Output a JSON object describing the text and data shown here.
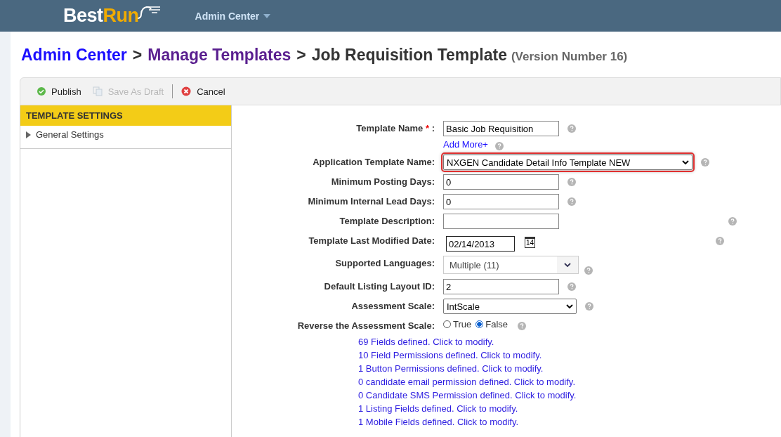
{
  "header": {
    "logo_first": "Best",
    "logo_second": "Run",
    "menu": "Admin Center"
  },
  "breadcrumb": [
    {
      "label": "Admin Center",
      "kind": "link"
    },
    {
      "separator": ">",
      "label": "Manage Templates",
      "kind": "visited"
    },
    {
      "separator": ">",
      "label": "Job Requisition Template",
      "kind": "current"
    }
  ],
  "version": "(Version Number 16)",
  "toolbar": [
    {
      "label": "Publish",
      "kind": "publish",
      "disabled": false
    },
    {
      "label": "Save As Draft",
      "kind": "draft",
      "disabled": true
    },
    {
      "label": "Cancel",
      "kind": "cancel",
      "disabled": false
    }
  ],
  "sidebar": {
    "title": "TEMPLATE SETTINGS",
    "items": [
      {
        "label": "General Settings",
        "expanded": false
      }
    ]
  },
  "form": [
    {
      "label": "Template Name",
      "required_mark": "*",
      "colon": ":",
      "kind": "text",
      "value": "Basic Job Requisition",
      "extra_link": "Add More+"
    },
    {
      "label": "Application Template Name:",
      "kind": "select",
      "value": "NXGEN Candidate Detail Info Template NEW",
      "highlighted": true
    },
    {
      "label": "Minimum Posting Days:",
      "kind": "text",
      "value": "0"
    },
    {
      "label": "Minimum Internal Lead Days:",
      "kind": "text",
      "value": "0"
    },
    {
      "label": "Template Description:",
      "kind": "text"
    },
    {
      "label": "Template Last Modified Date:",
      "kind": "date",
      "value": "02/14/2013",
      "calendar_day": "14"
    },
    {
      "label": "Supported Languages:",
      "kind": "multiselect",
      "value": "Multiple (11)"
    },
    {
      "label": "Default Listing Layout ID:",
      "kind": "text",
      "value": "2"
    },
    {
      "label": "Assessment Scale:",
      "kind": "select",
      "value": "IntScale",
      "highlighted": false
    },
    {
      "label": "Reverse the Assessment Scale:",
      "kind": "radio",
      "options": [
        {
          "label": "True",
          "selected": false
        },
        {
          "label": "False",
          "selected": true
        }
      ]
    }
  ],
  "links": [
    "69 Fields defined. Click to modify.",
    "10 Field Permissions defined. Click to modify.",
    "1 Button Permissions defined. Click to modify.",
    "0 candidate email permission defined. Click to modify.",
    "0 Candidate SMS Permission defined. Click to modify.",
    "1 Listing Fields defined. Click to modify.",
    "1 Mobile Fields defined. Click to modify."
  ]
}
